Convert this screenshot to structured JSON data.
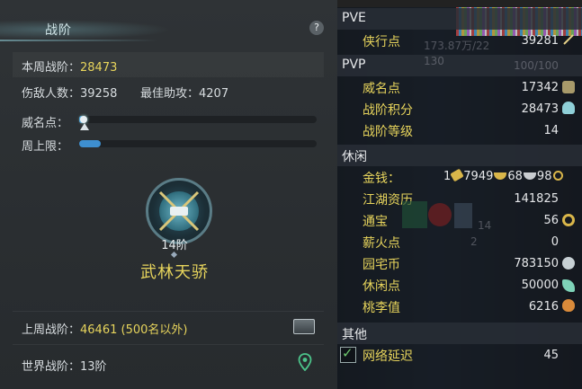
{
  "left": {
    "title": "战阶",
    "help": "?",
    "weekly_rank_label": "本周战阶：",
    "weekly_rank_value": "28473",
    "kills_label": "伤敌人数：",
    "kills_value": "39258",
    "assist_label": "最佳助攻：",
    "assist_value": "4207",
    "fame_label": "威名点：",
    "fame_progress": 0.02,
    "weekly_limit_label": "周上限：",
    "weekly_limit_progress": 0.09,
    "rank_level": "14阶",
    "rank_name": "武林天骄",
    "last_week_label": "上周战阶：",
    "last_week_value": "46461 (500名以外)",
    "world_label": "世界战阶：",
    "world_value": "13阶"
  },
  "right": {
    "pve": {
      "title": "PVE",
      "rows": [
        {
          "label": "侠行点",
          "value": "39281",
          "icon": "brush-icon",
          "ghost": "173.87万/22"
        }
      ]
    },
    "pvp": {
      "title": "PVP",
      "ghost_left": "130",
      "ghost_right": "100/100",
      "rows": [
        {
          "label": "威名点",
          "value": "17342",
          "icon": "mask-icon"
        },
        {
          "label": "战阶积分",
          "value": "28473",
          "icon": "crystal-icon"
        },
        {
          "label": "战阶等级",
          "value": "14",
          "icon": ""
        }
      ]
    },
    "leisure": {
      "title": "休闲",
      "money_label": "金钱：",
      "money_gold": "1",
      "money_silver": "7949",
      "money_copper": "68",
      "money_wen": "98",
      "rows": [
        {
          "label": "江湖资历",
          "value": "141825",
          "icon": ""
        },
        {
          "label": "通宝",
          "value": "56",
          "icon": "coin-icon",
          "ghost": "14"
        },
        {
          "label": "薪火点",
          "value": "0",
          "icon": "",
          "ghost": "2"
        },
        {
          "label": "园宅币",
          "value": "783150",
          "icon": "cloud-coin-icon"
        },
        {
          "label": "休闲点",
          "value": "50000",
          "icon": "leaf-icon"
        },
        {
          "label": "桃李值",
          "value": "6216",
          "icon": "gourd-icon"
        }
      ]
    },
    "other": {
      "title": "其他",
      "latency_label": "网络延迟",
      "latency_value": "45",
      "latency_checked": true
    },
    "colors": {
      "label_gold": "#e7d45c",
      "progress_blue": "#3e8fd0"
    }
  }
}
